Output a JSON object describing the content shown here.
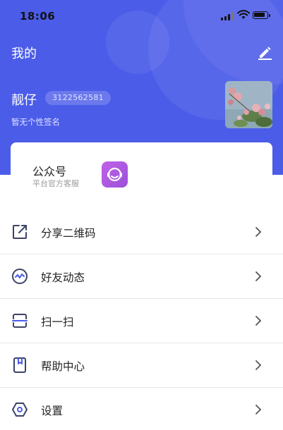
{
  "status": {
    "time": "18:06"
  },
  "header": {
    "title": "我的"
  },
  "profile": {
    "name": "靓仔",
    "uid": "3122562581",
    "signature": "暂无个性签名"
  },
  "account_card": {
    "title": "公众号",
    "subtitle": "平台官方客服"
  },
  "menu": [
    {
      "label": "分享二维码",
      "icon": "share-icon"
    },
    {
      "label": "好友动态",
      "icon": "activity-icon"
    },
    {
      "label": "扫一扫",
      "icon": "scan-icon"
    },
    {
      "label": "帮助中心",
      "icon": "book-icon"
    },
    {
      "label": "设置",
      "icon": "settings-icon"
    }
  ],
  "colors": {
    "brand": "#4b5ce9",
    "icon": "#3c4366",
    "accent": "#9b4fd8"
  }
}
